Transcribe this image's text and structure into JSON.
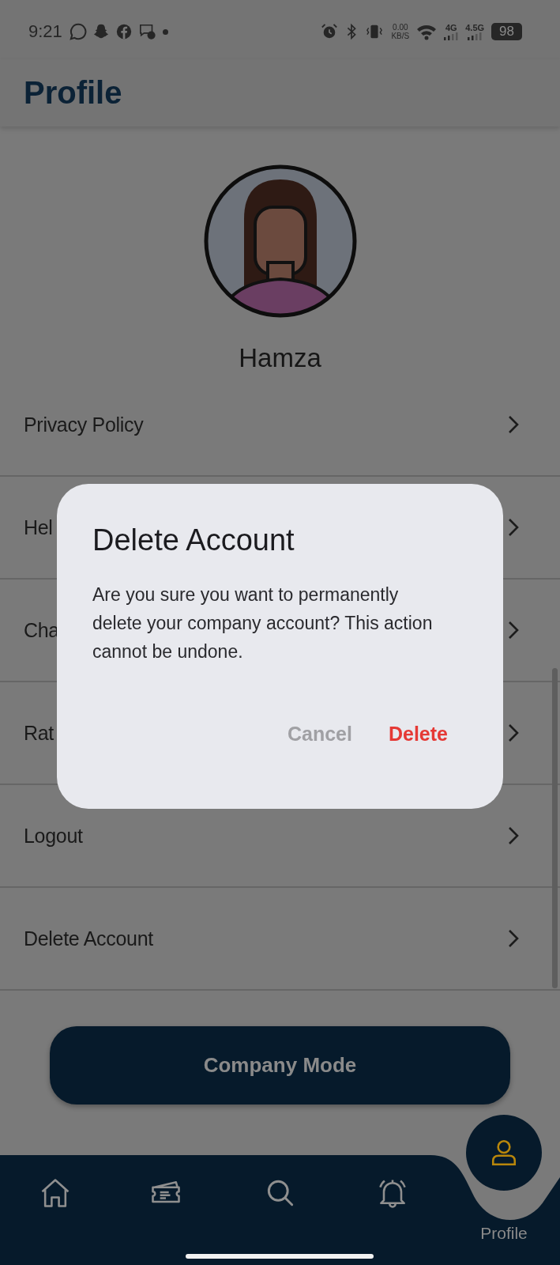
{
  "status_bar": {
    "time": "9:21",
    "speed_value": "0.00",
    "speed_unit": "KB/S",
    "signal_1_label": "4G",
    "signal_2_label": "4.5G",
    "battery": "98"
  },
  "header": {
    "title": "Profile"
  },
  "profile": {
    "name": "Hamza"
  },
  "menu_items": [
    {
      "label": "Privacy Policy"
    },
    {
      "label": "Hel"
    },
    {
      "label": "Cha"
    },
    {
      "label": "Rat"
    },
    {
      "label": "Logout"
    },
    {
      "label": "Delete Account"
    }
  ],
  "company_mode_button": {
    "label": "Company Mode"
  },
  "dialog": {
    "title": "Delete Account",
    "message": "Are you sure you want to permanently delete your company account? This action cannot be undone.",
    "buttons": [
      {
        "label": "Cancel",
        "kind": "cancel"
      },
      {
        "label": "Delete",
        "kind": "destructive"
      }
    ]
  },
  "bottom_nav": [
    {
      "kind": "home",
      "selected": false
    },
    {
      "kind": "tickets",
      "selected": false
    },
    {
      "kind": "search",
      "selected": false
    },
    {
      "kind": "notifications",
      "selected": false
    },
    {
      "kind": "profile",
      "selected": true,
      "label": "Profile"
    }
  ]
}
